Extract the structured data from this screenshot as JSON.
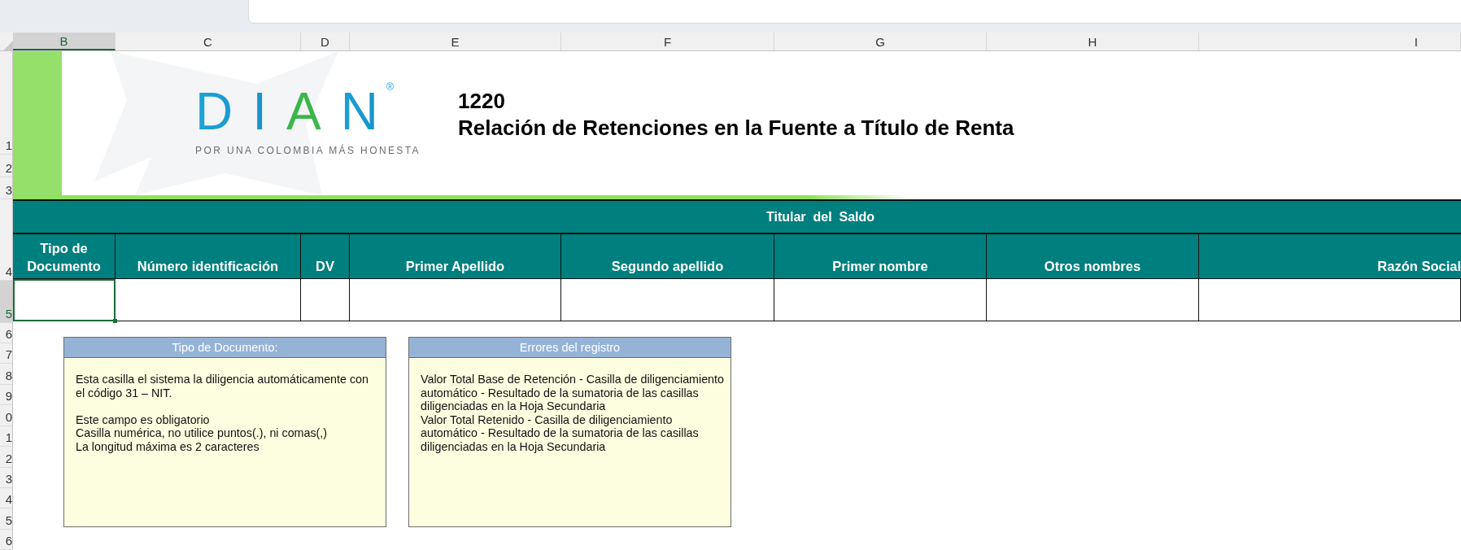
{
  "column_headers": [
    {
      "label": "B",
      "selected": true
    },
    {
      "label": "C",
      "selected": false
    },
    {
      "label": "D",
      "selected": false
    },
    {
      "label": "E",
      "selected": false
    },
    {
      "label": "F",
      "selected": false
    },
    {
      "label": "G",
      "selected": false
    },
    {
      "label": "H",
      "selected": false
    },
    {
      "label": "I",
      "selected": false
    }
  ],
  "row_headers": [
    {
      "label": "1",
      "selected": false
    },
    {
      "label": "2",
      "selected": false
    },
    {
      "label": "3",
      "selected": false
    },
    {
      "label": "4",
      "selected": false
    },
    {
      "label": "5",
      "selected": true
    },
    {
      "label": "6",
      "selected": false
    },
    {
      "label": "7",
      "selected": false
    },
    {
      "label": "8",
      "selected": false
    },
    {
      "label": "9",
      "selected": false
    },
    {
      "label": "0",
      "selected": false
    },
    {
      "label": "1",
      "selected": false
    },
    {
      "label": "2",
      "selected": false
    },
    {
      "label": "3",
      "selected": false
    },
    {
      "label": "4",
      "selected": false
    },
    {
      "label": "5",
      "selected": false
    },
    {
      "label": "6",
      "selected": false
    }
  ],
  "banner": {
    "logo": {
      "wordmark": "DIAN",
      "registered": "®",
      "tagline": "POR UNA COLOMBIA MÁS HONESTA"
    },
    "form_number": "1220",
    "form_title": "Relación de Retenciones en la Fuente a Título de Renta"
  },
  "table": {
    "group_header": "Titular  del  Saldo",
    "columns": [
      "Tipo de Documento",
      "Número identificación",
      "DV",
      "Primer Apellido",
      "Segundo apellido",
      "Primer nombre",
      "Otros nombres",
      "Razón Social"
    ],
    "data_row": [
      {
        "selected": true
      },
      {
        "selected": false
      },
      {
        "selected": false
      },
      {
        "selected": false
      },
      {
        "selected": false
      },
      {
        "selected": false
      },
      {
        "selected": false
      },
      {
        "selected": false
      }
    ]
  },
  "notes": [
    {
      "title": "Tipo de Documento:",
      "paragraphs": [
        [
          "Esta casilla el sistema la diligencia automáticamente con el código 31 – NIT."
        ],
        [
          "Este campo es obligatorio",
          "Casilla numérica, no utilice puntos(.), ni comas(,)",
          "La longitud máxima es 2 caracteres"
        ]
      ]
    },
    {
      "title": "Errores del registro",
      "paragraphs": [
        [
          "Valor Total Base de Retención - Casilla de diligenciamiento automático - Resultado de la sumatoria de las casillas diligenciadas en la Hoja Secundaria",
          "Valor Total Retenido - Casilla de diligenciamiento automático - Resultado de la sumatoria de las casillas diligenciadas en la Hoja Secundaria"
        ]
      ]
    }
  ]
}
